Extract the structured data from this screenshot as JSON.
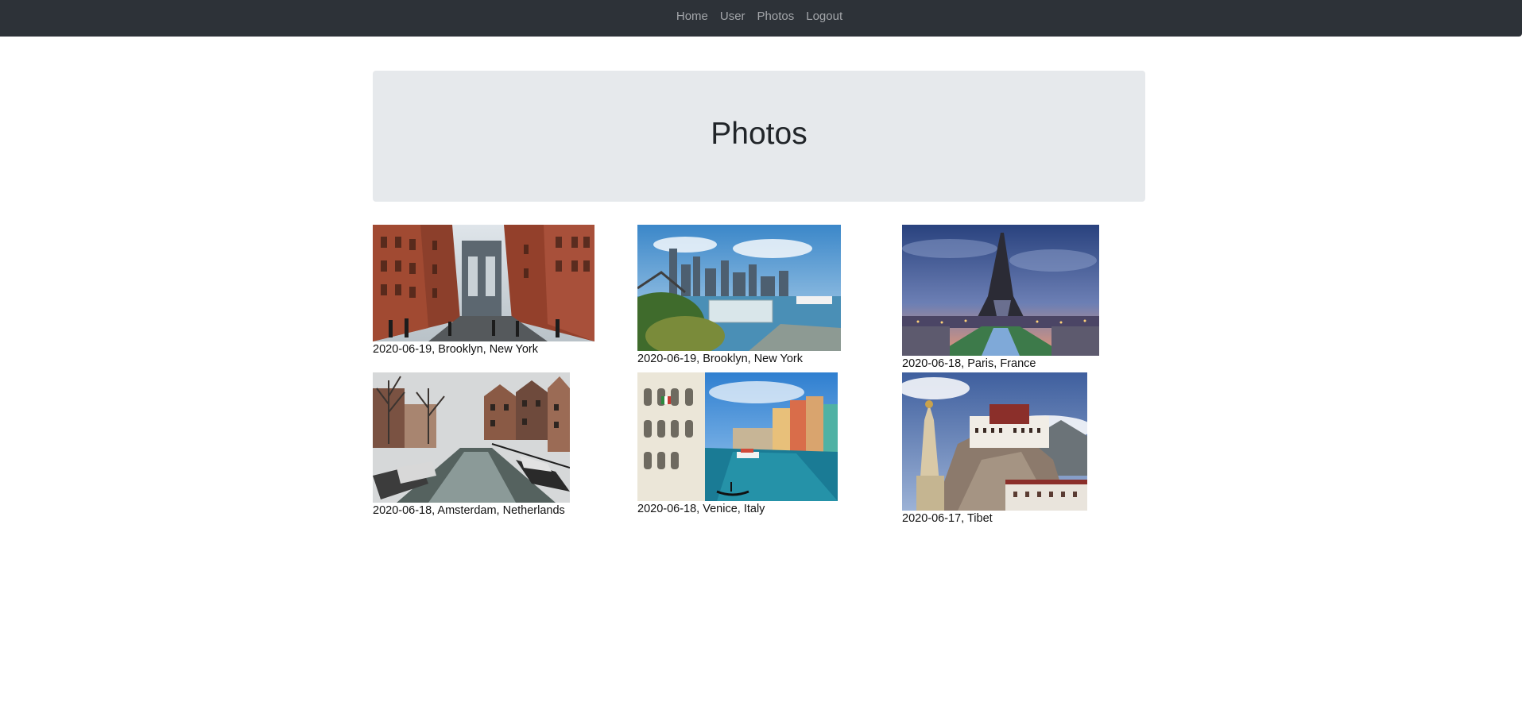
{
  "nav": {
    "items": [
      {
        "label": "Home"
      },
      {
        "label": "User"
      },
      {
        "label": "Photos"
      },
      {
        "label": "Logout"
      }
    ]
  },
  "header": {
    "title": "Photos"
  },
  "photos": [
    {
      "caption": "2020-06-19, Brooklyn, New York"
    },
    {
      "caption": "2020-06-19, Brooklyn, New York"
    },
    {
      "caption": "2020-06-18, Paris, France"
    },
    {
      "caption": "2020-06-18, Amsterdam, Netherlands"
    },
    {
      "caption": "2020-06-18, Venice, Italy"
    },
    {
      "caption": "2020-06-17, Tibet"
    }
  ]
}
